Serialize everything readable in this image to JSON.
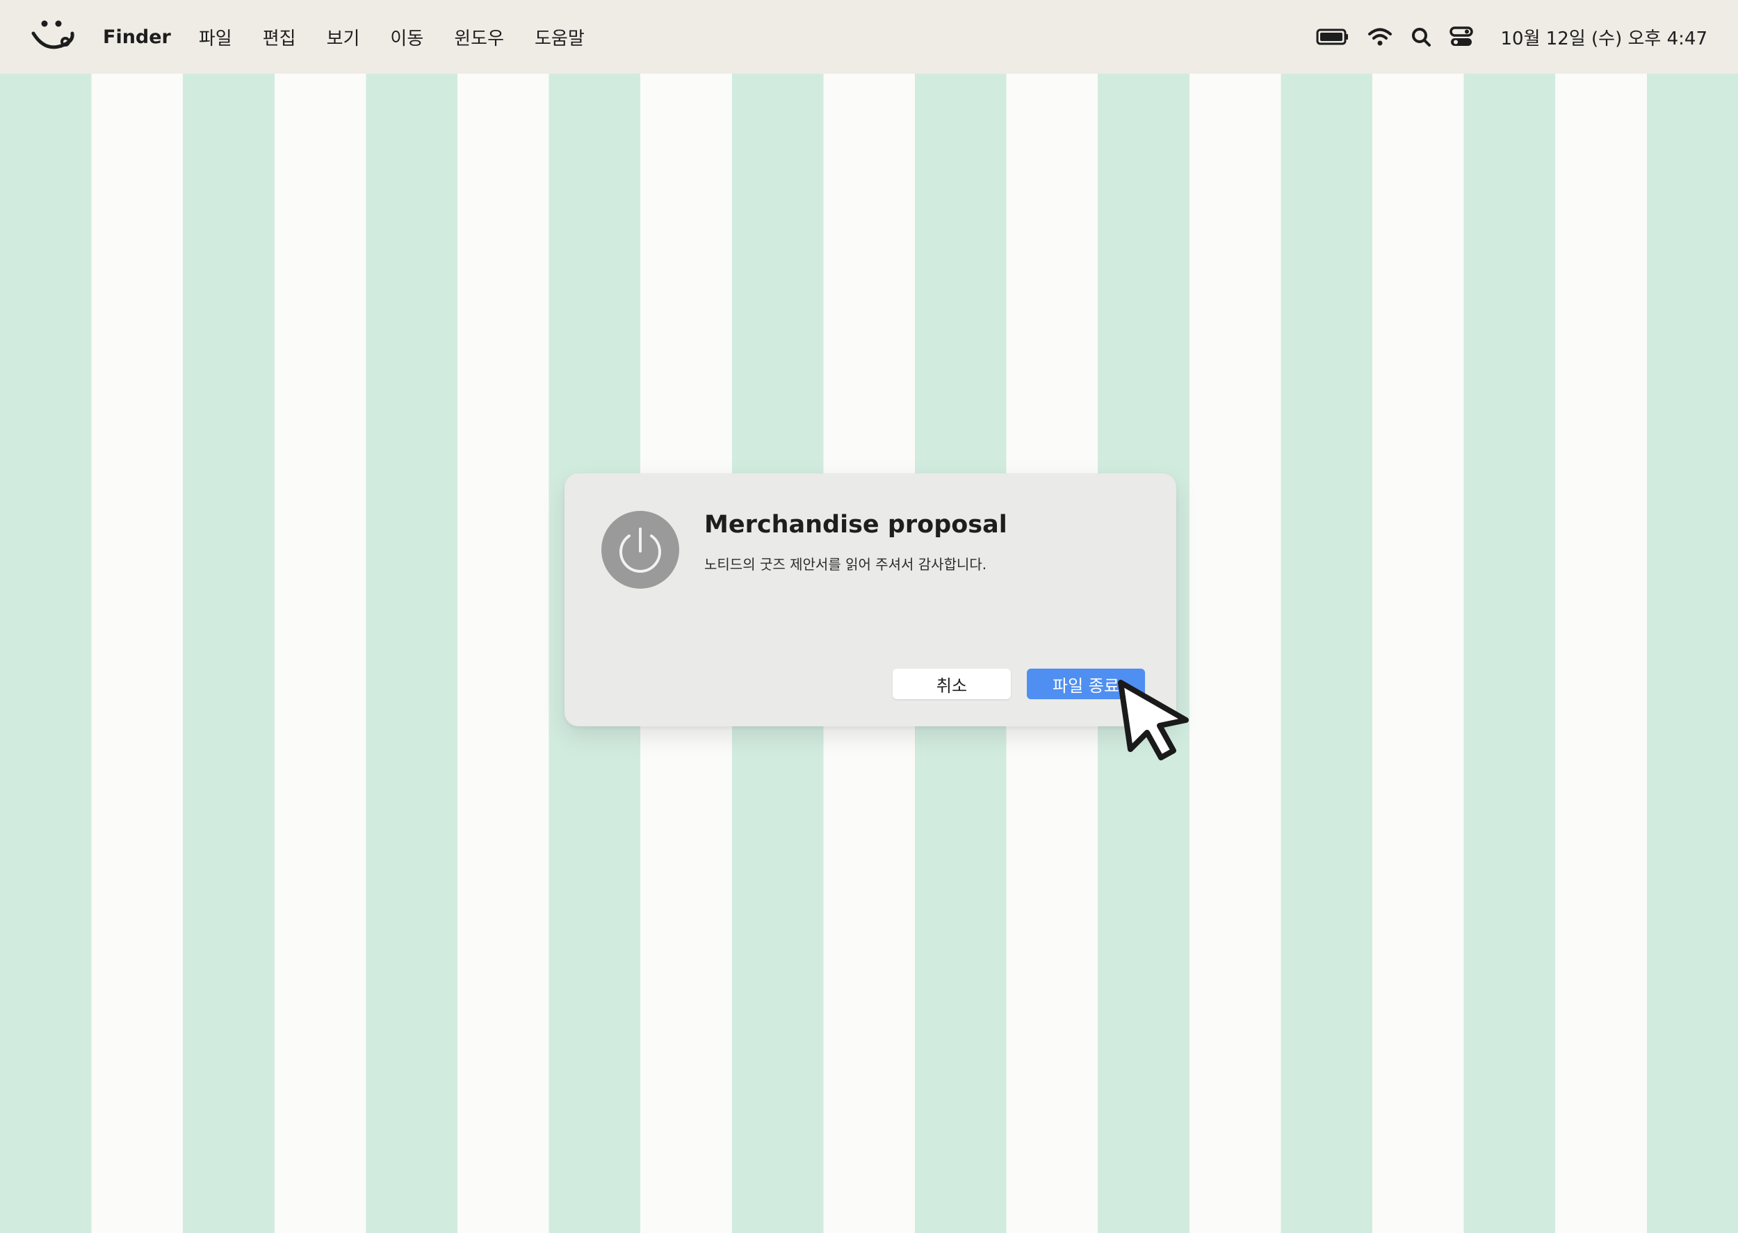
{
  "menubar": {
    "app_name": "Finder",
    "items": [
      "파일",
      "편집",
      "보기",
      "이동",
      "윈도우",
      "도움말"
    ],
    "status_icons": [
      "battery-icon",
      "wifi-icon",
      "search-icon",
      "control-center-icon"
    ],
    "clock": "10월 12일 (수) 오후 4:47"
  },
  "dialog": {
    "icon": "power-icon",
    "title": "Merchandise proposal",
    "message": "노티드의 굿즈 제안서를 읽어 주셔서 감사합니다.",
    "cancel_label": "취소",
    "confirm_label": "파일 종료"
  },
  "colors": {
    "stripe_green": "#d2ebdf",
    "stripe_white": "#fbfbf9",
    "menubar_bg": "#efebe5",
    "dialog_bg": "#eaeae8",
    "accent_blue": "#4f8ff2",
    "power_icon_bg": "#9a9a9a"
  }
}
